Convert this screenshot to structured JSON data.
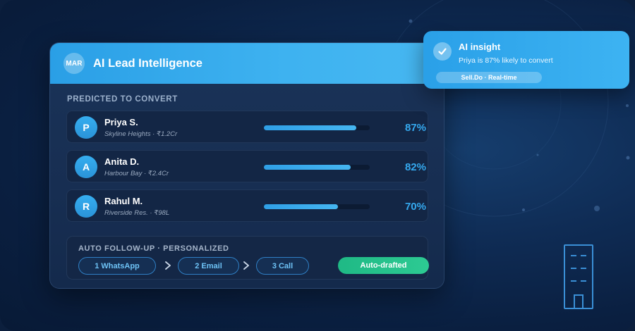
{
  "card": {
    "badge": "MAR",
    "title": "AI Lead Intelligence",
    "section_label": "PREDICTED TO CONVERT",
    "leads": [
      {
        "initial": "P",
        "name": "Priya S.",
        "detail": "Skyline Heights · ₹1.2Cr",
        "probability": 0.87,
        "percent_label": "87%"
      },
      {
        "initial": "A",
        "name": "Anita D.",
        "detail": "Harbour Bay · ₹2.4Cr",
        "probability": 0.82,
        "percent_label": "82%"
      },
      {
        "initial": "R",
        "name": "Rahul M.",
        "detail": "Riverside Res. · ₹98L",
        "probability": 0.7,
        "percent_label": "70%"
      }
    ],
    "followup": {
      "label": "AUTO FOLLOW-UP · PERSONALIZED",
      "steps": [
        "1 WhatsApp",
        "2 Email",
        "3 Call"
      ],
      "status_button": "Auto-drafted"
    }
  },
  "insight": {
    "title": "AI insight",
    "text": "Priya is 87% likely to convert",
    "tag": "Sell.Do · Real-time"
  },
  "icons": {
    "check": "check-icon",
    "chevron": "chevron-right-icon",
    "building": "building-icon"
  },
  "colors": {
    "accent": "#35a9ef",
    "header": "#3eb2f0",
    "success": "#2dca93",
    "background": "#0c1f3d"
  }
}
